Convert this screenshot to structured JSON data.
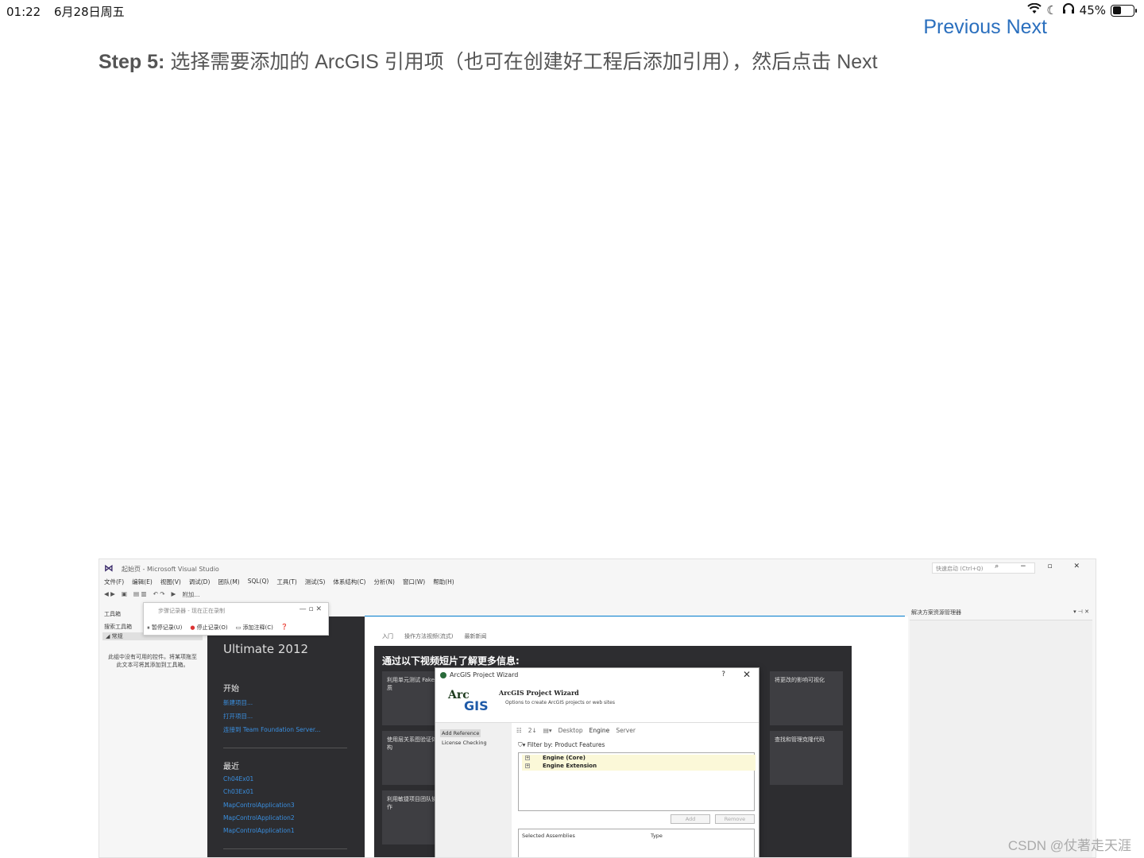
{
  "status_bar": {
    "time": "01:22",
    "date": "6月28日周五",
    "battery_text": "45%",
    "battery_level": 0.45,
    "icons": [
      "wifi-icon",
      "moon-icon",
      "headphones-icon",
      "battery-icon"
    ]
  },
  "page_nav": {
    "previous": "Previous",
    "next": "Next"
  },
  "step": {
    "label": "Step 5:",
    "text": "选择需要添加的 ArcGIS 引用项（也可在创建好工程后添加引用），然后点击 Next"
  },
  "vs": {
    "title": "起始页 - Microsoft Visual Studio",
    "quick_launch": "快速启动 (Ctrl+Q)",
    "menu": [
      "文件(F)",
      "编辑(E)",
      "视图(V)",
      "调试(D)",
      "团队(M)",
      "SQL(Q)",
      "工具(T)",
      "测试(S)",
      "体系结构(C)",
      "分析(N)",
      "窗口(W)",
      "帮助(H)"
    ],
    "toolbar_attach": "附加...",
    "toolbox": {
      "title": "工具箱",
      "search": "搜索工具箱",
      "section": "◢ 常规",
      "empty": "此组中没有可用的控件。将某项拖至此文本可将其添加到工具箱。"
    },
    "recorder": {
      "title": "步骤记录器 - 现在正在录制",
      "pause": "暂停记录(U)",
      "stop": "停止记录(O)",
      "comment": "添加注释(C)"
    },
    "start_page": {
      "edition": "Ultimate 2012",
      "start_heading": "开始",
      "start_links": [
        "新建项目...",
        "打开项目...",
        "连接到 Team Foundation Server..."
      ],
      "recent_heading": "最近",
      "recent_links": [
        "Ch04Ex01",
        "Ch03Ex01",
        "MapControlApplication3",
        "MapControlApplication2",
        "MapControlApplication1"
      ]
    },
    "center": {
      "tabs": [
        "入门",
        "操作方法视频(流式)",
        "最新新闻"
      ],
      "heading": "通过以下视频短片了解更多信息:",
      "tiles": [
        "利用单元测试 Fakes 提高质",
        "将更改的影响可视化",
        "使用层关系图验证体系结构",
        "查找和管理克隆代码",
        "利用敏捷项目团队协同工作"
      ]
    },
    "solution_explorer": {
      "title": "解决方案资源管理器"
    }
  },
  "wizard": {
    "window_title": "ArcGIS Project Wizard",
    "help": "?",
    "close": "✕",
    "logo_arc": "Arc",
    "logo_gis": "GIS",
    "heading": "ArcGIS Project Wizard",
    "subheading": "Options to create ArcGIS projects or web sites",
    "nav": [
      "Add Reference",
      "License Checking"
    ],
    "toolbar": [
      "Desktop",
      "Engine",
      "Server"
    ],
    "filter_label": "Filter by:",
    "filter_value": "Product Features",
    "tree": [
      "Engine (Core)",
      "Engine Extension"
    ],
    "add": "Add",
    "remove": "Remove",
    "col_assemblies": "Selected Assemblies",
    "col_type": "Type"
  },
  "watermark": "CSDN @仗著走天涯"
}
